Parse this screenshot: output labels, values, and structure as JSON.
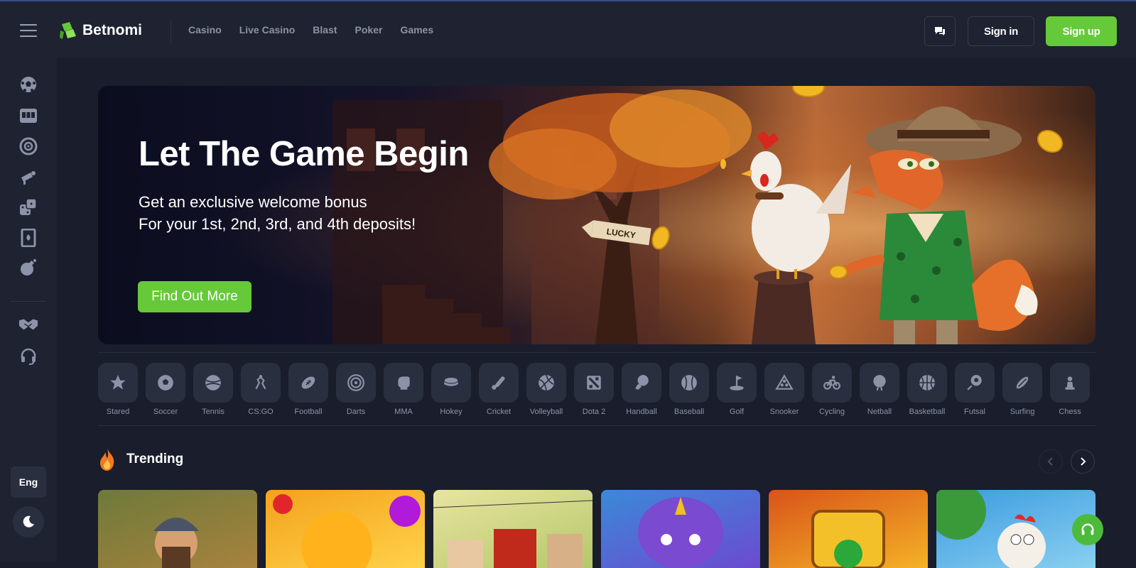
{
  "app": {
    "name": "Betnomi"
  },
  "header": {
    "nav": [
      "Casino",
      "Live Casino",
      "Blast",
      "Poker",
      "Games"
    ],
    "sign_in": "Sign in",
    "sign_up": "Sign up"
  },
  "sidebar": {
    "icons": [
      "sports-ball-icon",
      "slot-machine-icon",
      "roulette-icon",
      "megaphone-icon",
      "dice-icon",
      "playing-card-icon",
      "bomb-icon",
      "handshake-icon",
      "headset-icon"
    ],
    "language": "Eng"
  },
  "banner": {
    "title": "Let The Game Begin",
    "subtitle_line1": "Get an exclusive welcome bonus",
    "subtitle_line2": "For your 1st, 2nd, 3rd, and 4th deposits!",
    "cta": "Find Out More",
    "sign_text": "LUCKY"
  },
  "sports": [
    {
      "label": "Stared",
      "icon": "star-icon"
    },
    {
      "label": "Soccer",
      "icon": "soccer-icon"
    },
    {
      "label": "Tennis",
      "icon": "tennis-icon"
    },
    {
      "label": "CS:GO",
      "icon": "csgo-icon"
    },
    {
      "label": "Football",
      "icon": "football-icon"
    },
    {
      "label": "Darts",
      "icon": "darts-icon"
    },
    {
      "label": "MMA",
      "icon": "mma-icon"
    },
    {
      "label": "Hokey",
      "icon": "hockey-icon"
    },
    {
      "label": "Cricket",
      "icon": "cricket-icon"
    },
    {
      "label": "Volleyball",
      "icon": "volleyball-icon"
    },
    {
      "label": "Dota 2",
      "icon": "dota2-icon"
    },
    {
      "label": "Handball",
      "icon": "handball-icon"
    },
    {
      "label": "Baseball",
      "icon": "baseball-icon"
    },
    {
      "label": "Golf",
      "icon": "golf-icon"
    },
    {
      "label": "Snooker",
      "icon": "snooker-icon"
    },
    {
      "label": "Cycling",
      "icon": "cycling-icon"
    },
    {
      "label": "Netball",
      "icon": "netball-icon"
    },
    {
      "label": "Basketball",
      "icon": "basketball-icon"
    },
    {
      "label": "Futsal",
      "icon": "futsal-icon"
    },
    {
      "label": "Surfing",
      "icon": "surfing-icon"
    },
    {
      "label": "Chess",
      "icon": "chess-icon"
    }
  ],
  "trending": {
    "title": "Trending",
    "cards": [
      {
        "theme": "explorer",
        "colors": [
          "#6e7a3a",
          "#a8823e"
        ]
      },
      {
        "theme": "fruit",
        "colors": [
          "#f3a21c",
          "#ffd24a"
        ]
      },
      {
        "theme": "western",
        "colors": [
          "#e8e4a0",
          "#b4c86a"
        ]
      },
      {
        "theme": "monster",
        "colors": [
          "#3a8ad8",
          "#6c4ad0"
        ]
      },
      {
        "theme": "gems",
        "colors": [
          "#d8541a",
          "#f4b226"
        ]
      },
      {
        "theme": "chicken",
        "colors": [
          "#3a9ae0",
          "#8ad0f0"
        ]
      }
    ]
  },
  "colors": {
    "accent": "#66c93a",
    "background": "#1a1d2b",
    "panel": "#1e2231",
    "tile": "#2a2f40",
    "muted_text": "#8c93a8"
  }
}
